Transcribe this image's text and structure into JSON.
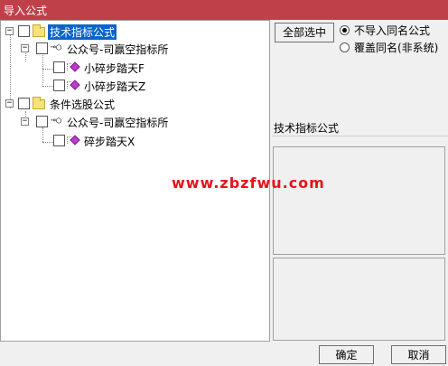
{
  "window": {
    "title": "导入公式"
  },
  "tree": {
    "nodes": [
      {
        "label": "技术指标公式",
        "type": "folder",
        "selected": true
      },
      {
        "label": "公众号-司赢空指标所",
        "type": "group"
      },
      {
        "label": "小碎步踏天F",
        "type": "formula"
      },
      {
        "label": "小碎步踏天Z",
        "type": "formula"
      },
      {
        "label": "条件选股公式",
        "type": "folder"
      },
      {
        "label": "公众号-司赢空指标所",
        "type": "group"
      },
      {
        "label": "碎步踏天X",
        "type": "formula"
      }
    ]
  },
  "side": {
    "select_all_label": "全部选中",
    "options": [
      {
        "label": "不导入同名公式",
        "checked": true
      },
      {
        "label": "覆盖同名(非系统)",
        "checked": false
      }
    ],
    "category_label": "技术指标公式"
  },
  "footer": {
    "ok_label": "确定",
    "cancel_label": "取消"
  },
  "watermark": "www.zbzfwu.com",
  "colors": {
    "titlebar": "#c0404a",
    "selection": "#0a64c8",
    "watermark": "#e8121a",
    "formula_icon": "#c03bd0"
  }
}
